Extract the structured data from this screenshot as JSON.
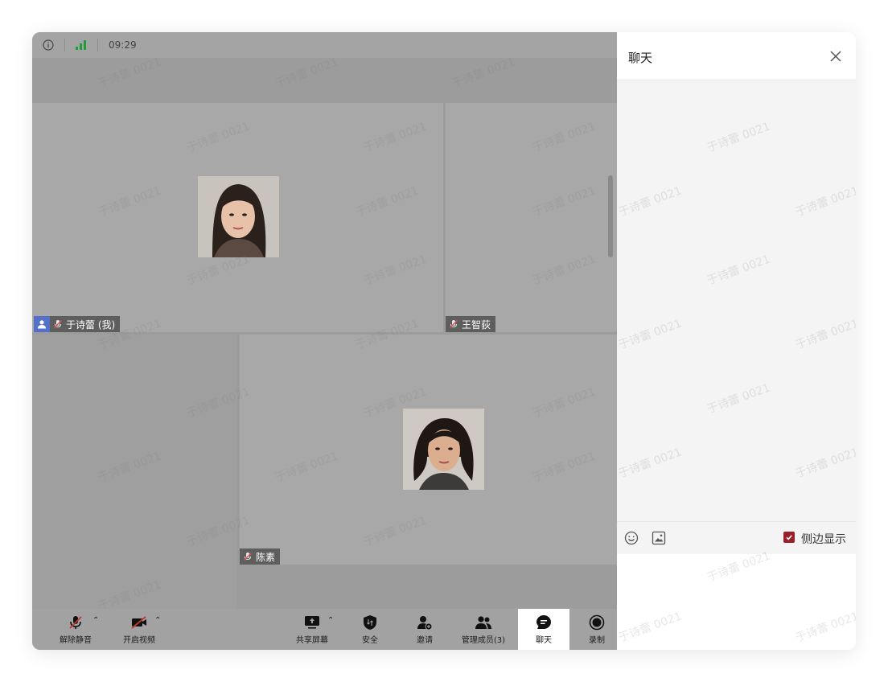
{
  "topbar": {
    "time": "09:29",
    "icons": [
      "info-icon",
      "signal-icon"
    ]
  },
  "participants": [
    {
      "name": "于诗蕾 (我)",
      "is_self": true
    },
    {
      "name": "王智荻",
      "is_self": false
    },
    {
      "name": "陈素",
      "is_self": false
    }
  ],
  "watermark": "于诗蕾 0021",
  "toolbar": {
    "unmute": "解除静音",
    "start_video": "开启视频",
    "share_screen": "共享屏幕",
    "security": "安全",
    "invite": "邀请",
    "manage_members": "管理成员(3)",
    "chat": "聊天",
    "record": "录制"
  },
  "chat": {
    "title": "聊天",
    "side_display_label": "侧边显示",
    "side_display_checked": true
  },
  "colors": {
    "accent_red": "#9a1f2b",
    "self_badge_blue": "#5470c9",
    "signal_green": "#1e9e3a"
  }
}
